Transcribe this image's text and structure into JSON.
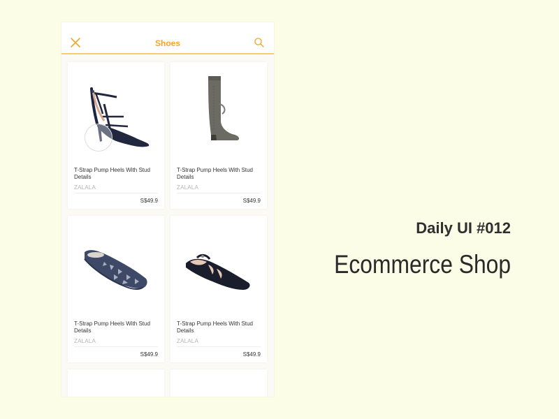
{
  "header": {
    "title": "Shoes",
    "close_icon": "close-icon",
    "search_icon": "search-icon",
    "accent_color": "#f5a623"
  },
  "products": [
    {
      "name": "T-Strap Pump Heels With Stud Details",
      "brand": "ZALALA",
      "price": "S$49.9",
      "image": "navy-t-strap-heel-pump"
    },
    {
      "name": "T-Strap Pump Heels With Stud Details",
      "brand": "ZALALA",
      "price": "S$49.9",
      "image": "grey-knee-high-boot"
    },
    {
      "name": "T-Strap Pump Heels With Stud Details",
      "brand": "ZALALA",
      "price": "S$49.9",
      "image": "navy-laser-cut-flat"
    },
    {
      "name": "T-Strap Pump Heels With Stud Details",
      "brand": "ZALALA",
      "price": "S$49.9",
      "image": "black-t-strap-pointed-flat"
    }
  ],
  "caption": {
    "subtitle": "Daily UI #012",
    "title": "Ecommerce Shop"
  }
}
